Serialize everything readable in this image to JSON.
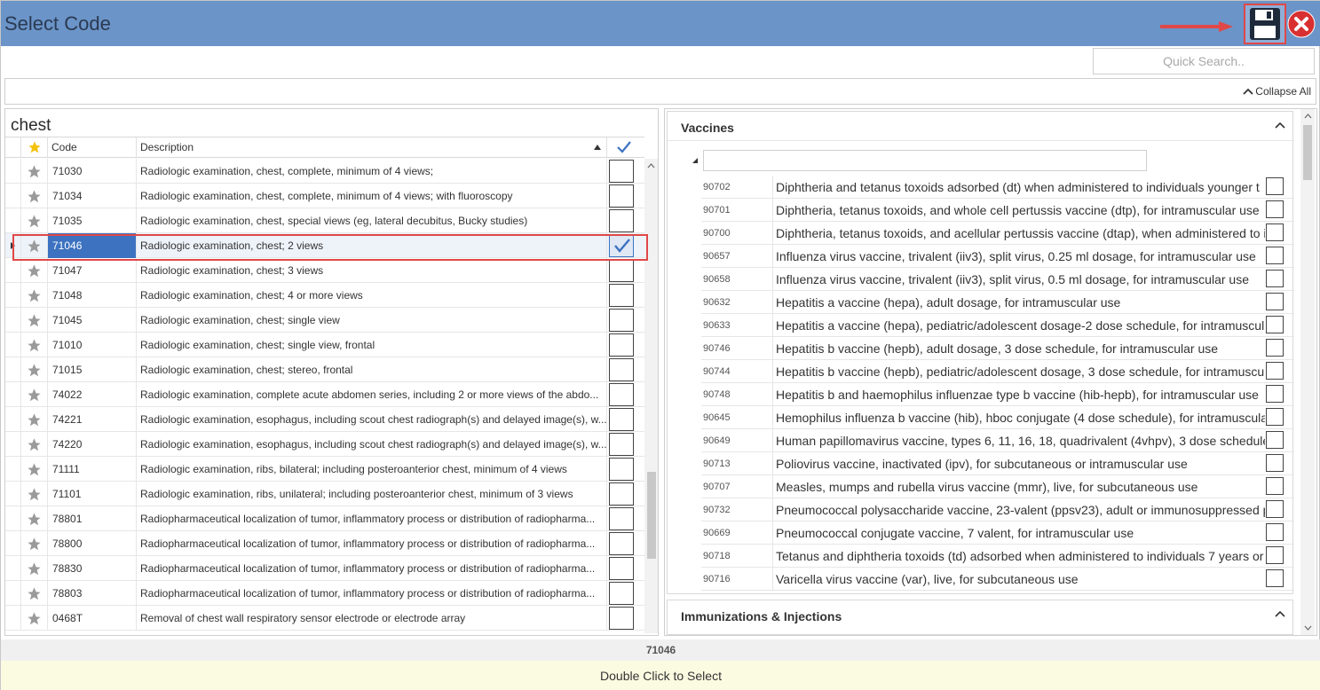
{
  "window": {
    "title": "Select Code"
  },
  "toolbar": {
    "save_icon": "floppy-disk-icon",
    "close_icon": "close-x-icon",
    "accent": "#6b94c8",
    "highlight": "#e04848"
  },
  "quick_search": {
    "placeholder": "Quick Search.."
  },
  "collapse_all": {
    "label": "Collapse All"
  },
  "left_grid": {
    "search_term": "chest",
    "columns": {
      "code": "Code",
      "description": "Description"
    },
    "selected_code": "71046",
    "rows": [
      {
        "code": "71030",
        "description": "Radiologic examination, chest, complete, minimum of 4 views;",
        "checked": false
      },
      {
        "code": "71034",
        "description": "Radiologic examination, chest, complete, minimum of 4 views; with fluoroscopy",
        "checked": false
      },
      {
        "code": "71035",
        "description": "Radiologic examination, chest, special views (eg, lateral decubitus, Bucky studies)",
        "checked": false
      },
      {
        "code": "71046",
        "description": "Radiologic examination, chest; 2 views",
        "checked": true,
        "selected": true
      },
      {
        "code": "71047",
        "description": "Radiologic examination, chest; 3 views",
        "checked": false
      },
      {
        "code": "71048",
        "description": "Radiologic examination, chest; 4 or more views",
        "checked": false
      },
      {
        "code": "71045",
        "description": "Radiologic examination, chest; single view",
        "checked": false
      },
      {
        "code": "71010",
        "description": "Radiologic examination, chest; single view, frontal",
        "checked": false
      },
      {
        "code": "71015",
        "description": "Radiologic examination, chest; stereo, frontal",
        "checked": false
      },
      {
        "code": "74022",
        "description": "Radiologic examination, complete acute abdomen series, including 2 or more views of the abdo...",
        "checked": false
      },
      {
        "code": "74221",
        "description": "Radiologic examination, esophagus, including scout chest radiograph(s) and delayed image(s), w...",
        "checked": false
      },
      {
        "code": "74220",
        "description": "Radiologic examination, esophagus, including scout chest radiograph(s) and delayed image(s), w...",
        "checked": false
      },
      {
        "code": "71111",
        "description": "Radiologic examination, ribs, bilateral; including posteroanterior chest, minimum of 4 views",
        "checked": false
      },
      {
        "code": "71101",
        "description": "Radiologic examination, ribs, unilateral; including posteroanterior chest, minimum of 3 views",
        "checked": false
      },
      {
        "code": "78801",
        "description": "Radiopharmaceutical localization of tumor, inflammatory process or distribution of radiopharma...",
        "checked": false
      },
      {
        "code": "78800",
        "description": "Radiopharmaceutical localization of tumor, inflammatory process or distribution of radiopharma...",
        "checked": false
      },
      {
        "code": "78830",
        "description": "Radiopharmaceutical localization of tumor, inflammatory process or distribution of radiopharma...",
        "checked": false
      },
      {
        "code": "78803",
        "description": "Radiopharmaceutical localization of tumor, inflammatory process or distribution of radiopharma...",
        "checked": false
      },
      {
        "code": "0468T",
        "description": "Removal of chest wall respiratory sensor electrode or electrode array",
        "checked": false
      }
    ]
  },
  "vaccines": {
    "title": "Vaccines",
    "rows": [
      {
        "code": "90702",
        "description": "Diphtheria and tetanus toxoids adsorbed (dt) when administered to individuals younger t"
      },
      {
        "code": "90701",
        "description": "Diphtheria, tetanus toxoids, and whole cell pertussis vaccine (dtp), for intramuscular use"
      },
      {
        "code": "90700",
        "description": "Diphtheria, tetanus toxoids, and acellular pertussis vaccine (dtap), when administered to i"
      },
      {
        "code": "90657",
        "description": "Influenza virus vaccine, trivalent (iiv3), split virus, 0.25 ml dosage, for intramuscular use"
      },
      {
        "code": "90658",
        "description": "Influenza virus vaccine, trivalent (iiv3), split virus, 0.5 ml dosage, for intramuscular use"
      },
      {
        "code": "90632",
        "description": "Hepatitis a vaccine (hepa), adult dosage, for intramuscular use"
      },
      {
        "code": "90633",
        "description": "Hepatitis a vaccine (hepa), pediatric/adolescent dosage-2 dose schedule, for intramuscul"
      },
      {
        "code": "90746",
        "description": "Hepatitis b vaccine (hepb), adult dosage, 3 dose schedule, for intramuscular use"
      },
      {
        "code": "90744",
        "description": "Hepatitis b vaccine (hepb), pediatric/adolescent dosage, 3 dose schedule, for intramuscu"
      },
      {
        "code": "90748",
        "description": "Hepatitis b and haemophilus influenzae type b vaccine (hib-hepb), for intramuscular use"
      },
      {
        "code": "90645",
        "description": "Hemophilus influenza b vaccine (hib), hboc conjugate (4 dose schedule), for intramuscula"
      },
      {
        "code": "90649",
        "description": "Human papillomavirus vaccine, types 6, 11, 16, 18, quadrivalent (4vhpv), 3 dose schedule,"
      },
      {
        "code": "90713",
        "description": "Poliovirus vaccine, inactivated (ipv), for subcutaneous or intramuscular use"
      },
      {
        "code": "90707",
        "description": "Measles, mumps and rubella virus vaccine (mmr), live, for subcutaneous use"
      },
      {
        "code": "90732",
        "description": "Pneumococcal polysaccharide vaccine, 23-valent (ppsv23), adult or immunosuppressed p"
      },
      {
        "code": "90669",
        "description": "Pneumococcal conjugate vaccine, 7 valent, for intramuscular use"
      },
      {
        "code": "90718",
        "description": "Tetanus and diphtheria toxoids (td) adsorbed when administered to individuals 7 years or"
      },
      {
        "code": "90716",
        "description": "Varicella virus vaccine (var), live, for subcutaneous use"
      }
    ]
  },
  "immunizations": {
    "title": "Immunizations & Injections"
  },
  "status": {
    "selected_code": "71046"
  },
  "footer": {
    "hint": "Double Click to Select"
  }
}
